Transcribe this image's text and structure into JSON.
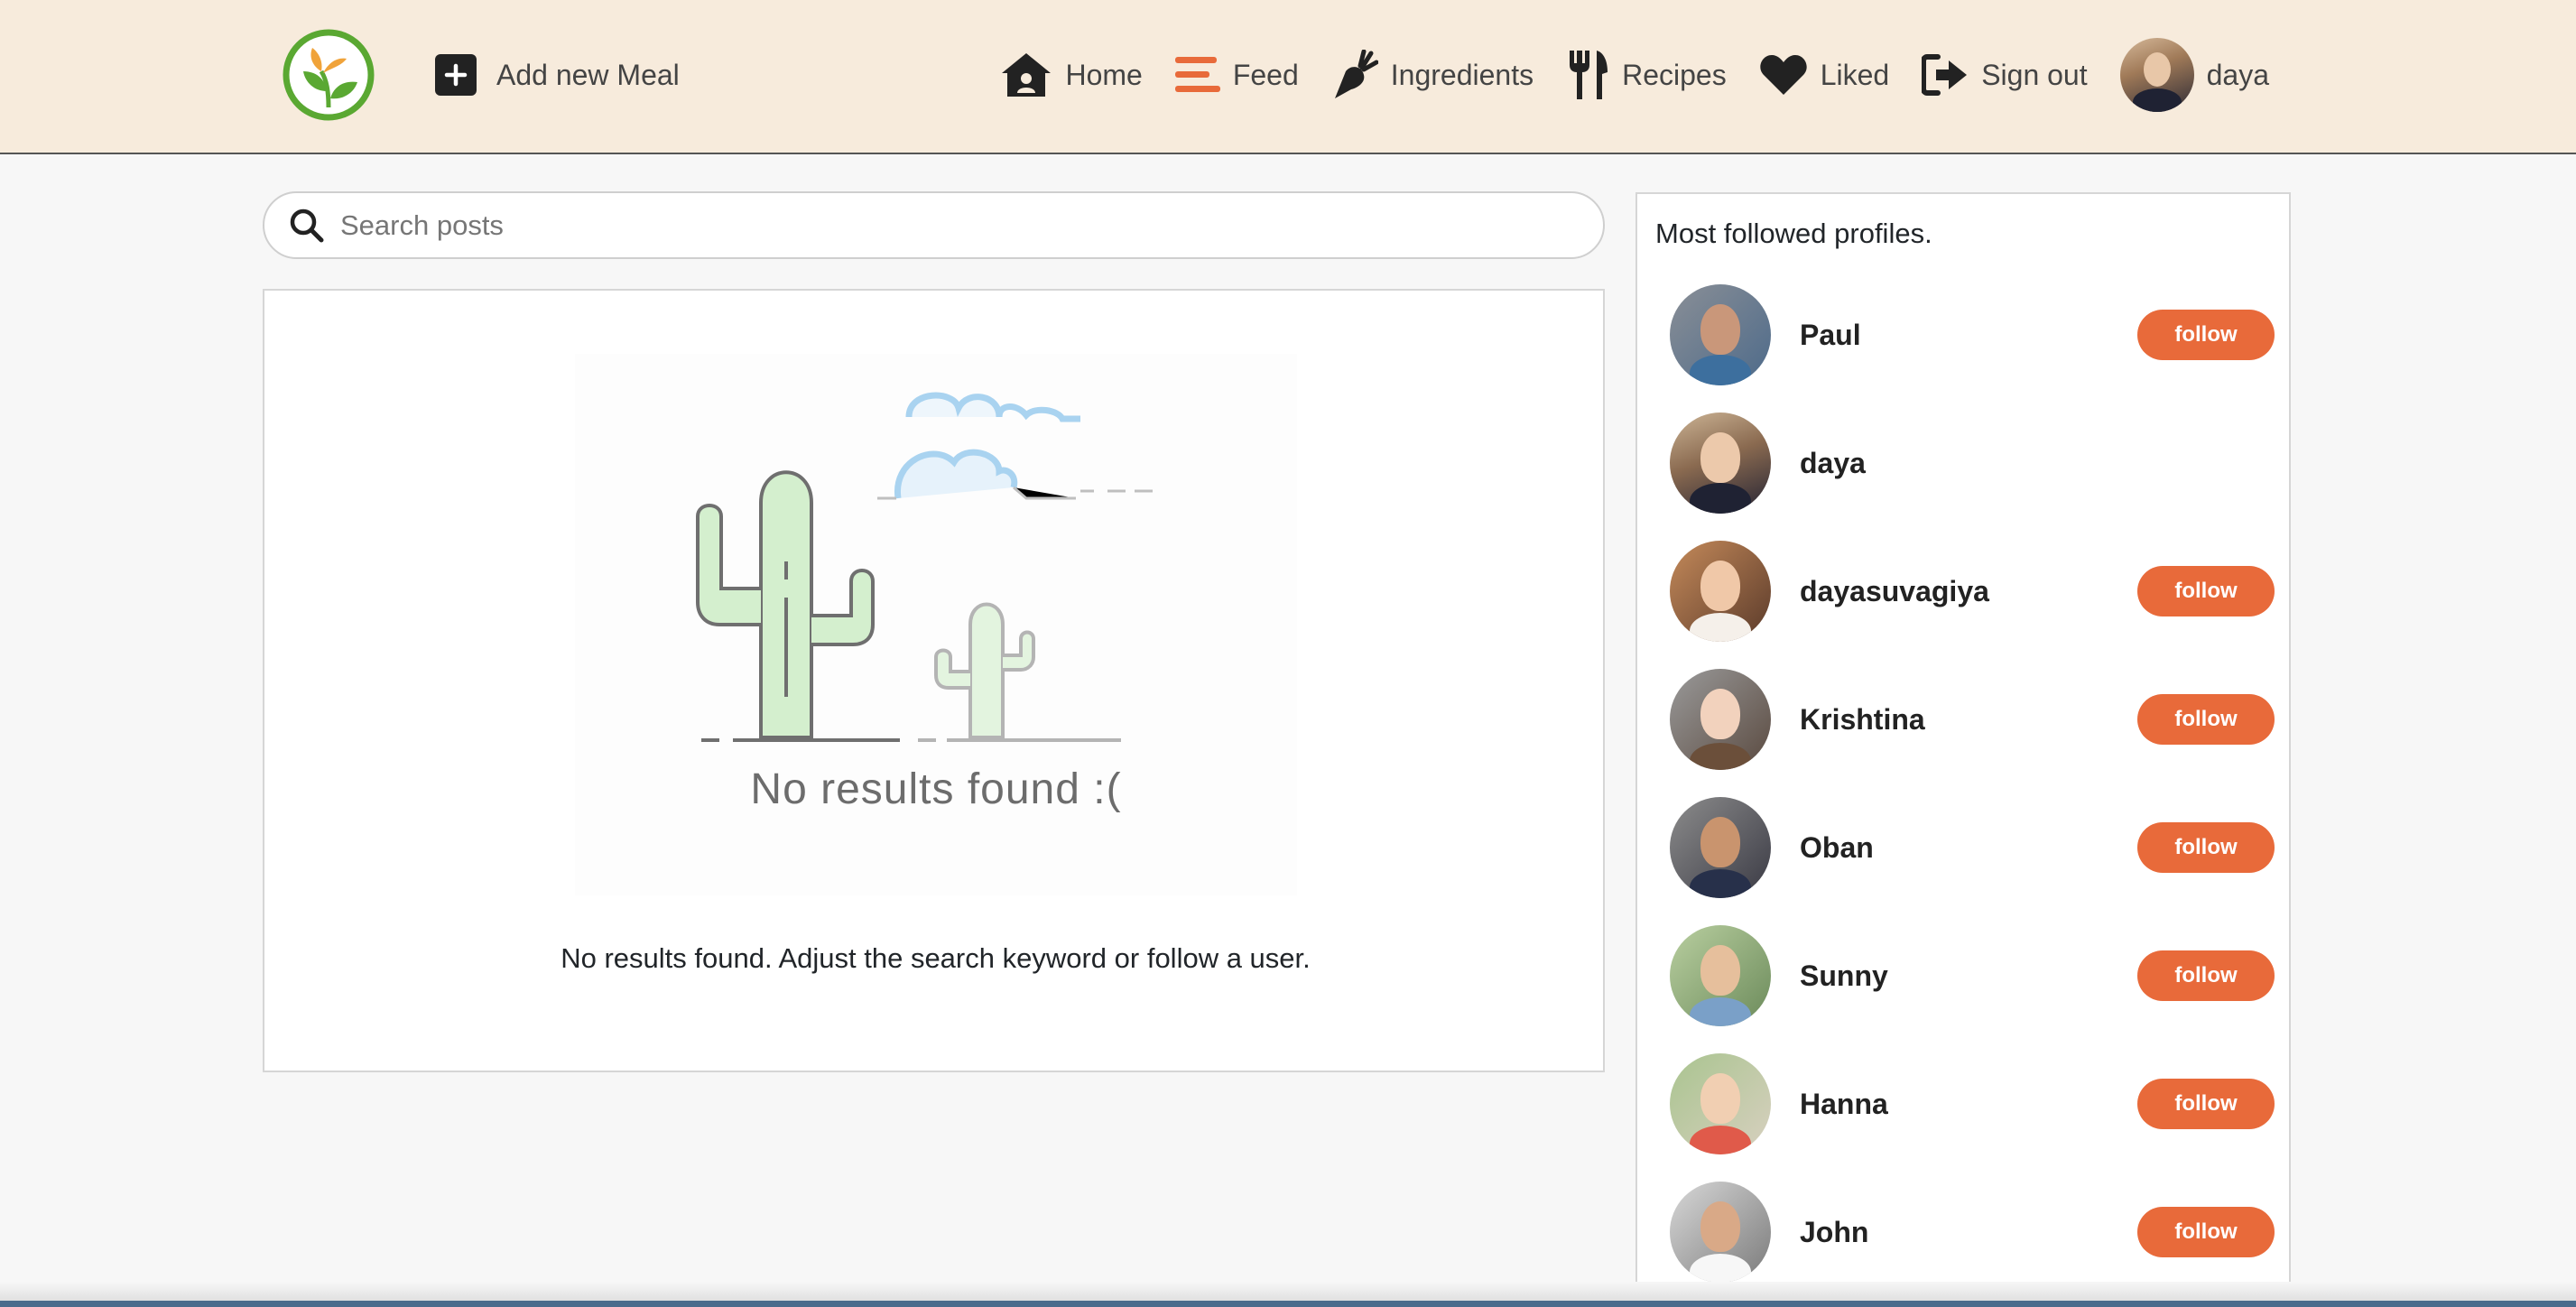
{
  "nav": {
    "add_meal": "Add new Meal",
    "links": [
      {
        "label": "Home",
        "icon": "home-icon"
      },
      {
        "label": "Feed",
        "icon": "feed-icon"
      },
      {
        "label": "Ingredients",
        "icon": "carrot-icon"
      },
      {
        "label": "Recipes",
        "icon": "utensils-icon"
      },
      {
        "label": "Liked",
        "icon": "heart-icon"
      },
      {
        "label": "Sign out",
        "icon": "sign-out-icon"
      }
    ],
    "user": "daya"
  },
  "search": {
    "placeholder": "Search posts"
  },
  "main": {
    "illustration_caption": "No results found :(",
    "empty_message": "No results found. Adjust the search keyword or follow a user."
  },
  "sidebar": {
    "title": "Most followed profiles.",
    "follow_label": "follow",
    "profiles": [
      {
        "name": "Paul",
        "can_follow": true
      },
      {
        "name": "daya",
        "can_follow": false
      },
      {
        "name": "dayasuvagiya",
        "can_follow": true
      },
      {
        "name": "Krishtina",
        "can_follow": true
      },
      {
        "name": "Oban",
        "can_follow": true
      },
      {
        "name": "Sunny",
        "can_follow": true
      },
      {
        "name": "Hanna",
        "can_follow": true
      },
      {
        "name": "John",
        "can_follow": true
      }
    ]
  },
  "colors": {
    "navbar_bg": "#f7ebdc",
    "accent": "#e86a3a",
    "page_bg": "#f7f7f7"
  }
}
